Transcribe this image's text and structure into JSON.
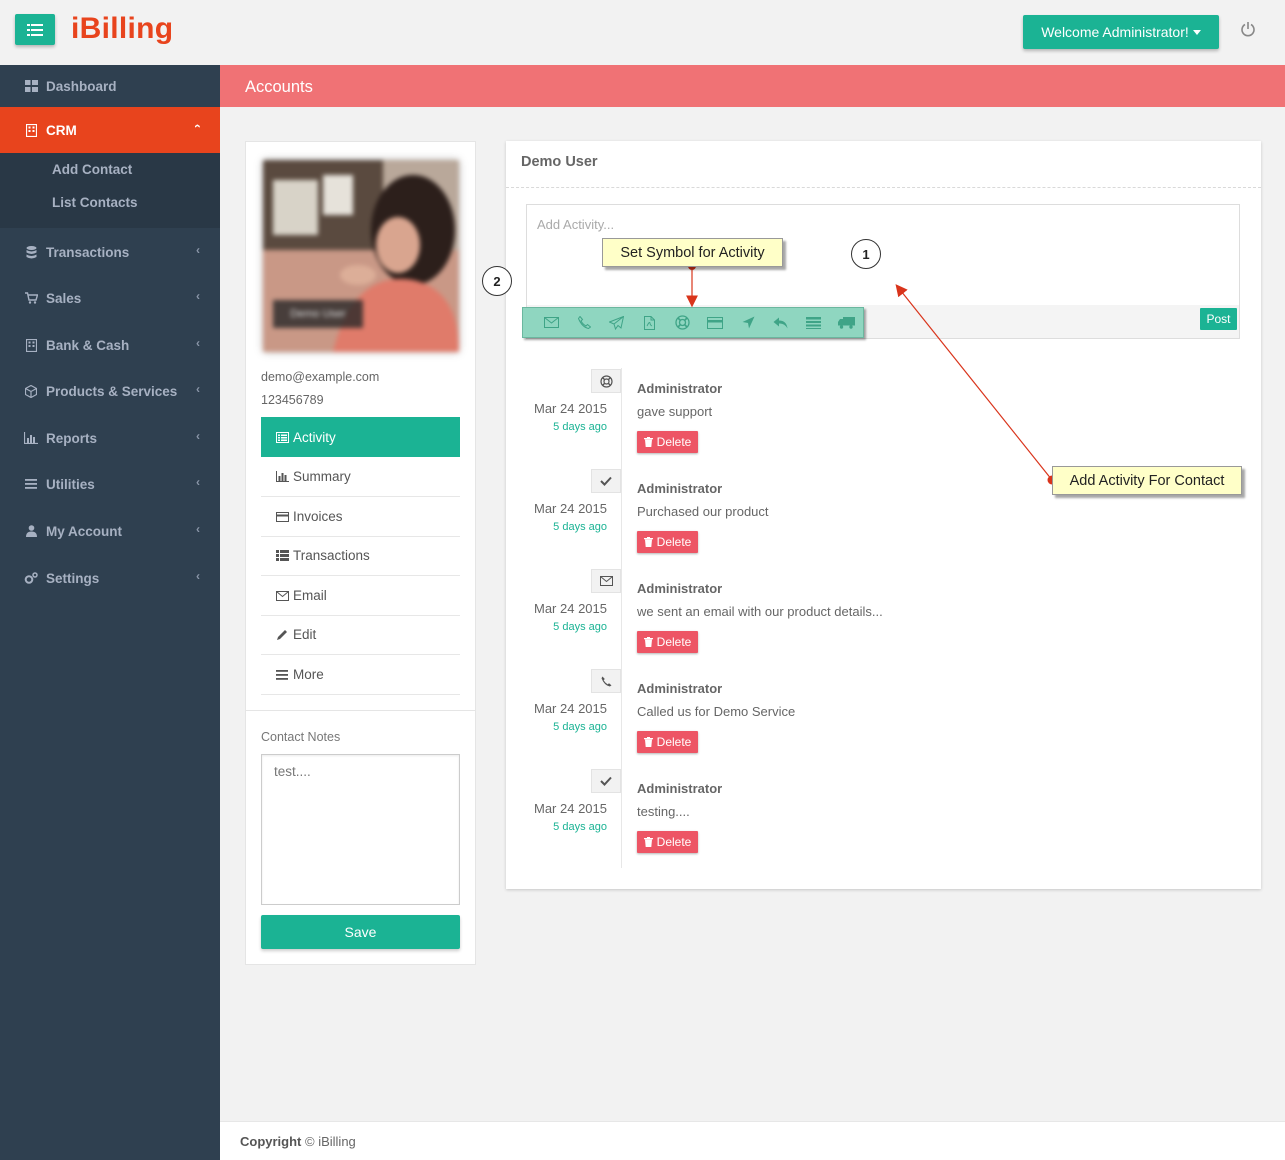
{
  "app": {
    "logo": "iBilling",
    "welcome": "Welcome Administrator!"
  },
  "sidebar": {
    "items": [
      {
        "label": "Dashboard"
      },
      {
        "label": "CRM"
      },
      {
        "label": "Transactions"
      },
      {
        "label": "Sales"
      },
      {
        "label": "Bank & Cash"
      },
      {
        "label": "Products & Services"
      },
      {
        "label": "Reports"
      },
      {
        "label": "Utilities"
      },
      {
        "label": "My Account"
      },
      {
        "label": "Settings"
      }
    ],
    "crm_sub": [
      "Add Contact",
      "List Contacts"
    ]
  },
  "page": {
    "title": "Accounts"
  },
  "contact": {
    "avatar_label": "Demo User",
    "email": "demo@example.com",
    "phone": "123456789",
    "tabs": [
      "Activity",
      "Summary",
      "Invoices",
      "Transactions",
      "Email",
      "Edit",
      "More"
    ],
    "notes_label": "Contact Notes",
    "notes_value": "test....",
    "save_label": "Save"
  },
  "main": {
    "title": "Demo User",
    "activity_placeholder": "Add Activity...",
    "post_label": "Post",
    "symbols": [
      "envelope-icon",
      "phone-icon",
      "paper-plane-icon",
      "file-pdf-icon",
      "life-ring-icon",
      "credit-card-icon",
      "location-arrow-icon",
      "reply-icon",
      "list-alt-icon",
      "truck-icon"
    ]
  },
  "timeline": [
    {
      "icon": "life-ring-icon",
      "date": "Mar 24 2015",
      "ago": "5 days ago",
      "author": "Administrator",
      "text": "gave support",
      "delete": "Delete"
    },
    {
      "icon": "check-icon",
      "date": "Mar 24 2015",
      "ago": "5 days ago",
      "author": "Administrator",
      "text": "Purchased our product",
      "delete": "Delete"
    },
    {
      "icon": "envelope-icon",
      "date": "Mar 24 2015",
      "ago": "5 days ago",
      "author": "Administrator",
      "text": "we sent an email with our product details...",
      "delete": "Delete"
    },
    {
      "icon": "phone-icon",
      "date": "Mar 24 2015",
      "ago": "5 days ago",
      "author": "Administrator",
      "text": "Called us for Demo Service",
      "delete": "Delete"
    },
    {
      "icon": "check-icon",
      "date": "Mar 24 2015",
      "ago": "5 days ago",
      "author": "Administrator",
      "text": "testing....",
      "delete": "Delete"
    }
  ],
  "annotations": {
    "symbol_callout": "Set Symbol for Activity",
    "activity_callout": "Add Activity For Contact",
    "num1": "1",
    "num2": "2"
  },
  "footer": {
    "label": "Copyright",
    "text": "© iBilling"
  },
  "colors": {
    "primary": "#1bb394",
    "accent": "#e8441d",
    "header": "#f07275",
    "sidebar": "#2f4050",
    "danger": "#ed5565"
  }
}
